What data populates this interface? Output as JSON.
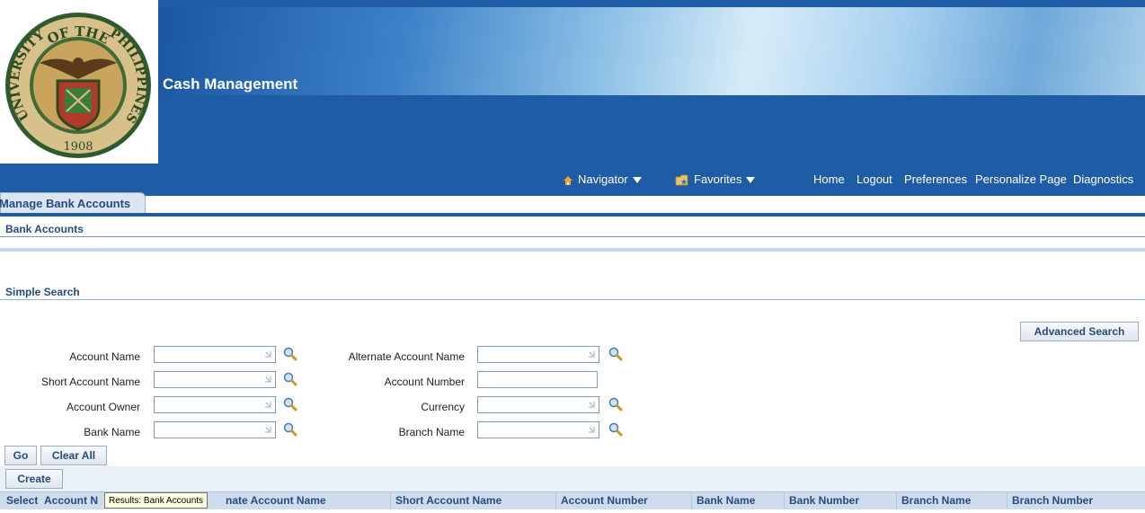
{
  "header": {
    "app_title": "Cash Management",
    "seal": {
      "top_text": "OF THE",
      "left_text": "UNIVERSITY",
      "right_text": "PHILIPPINES",
      "year": "1908"
    }
  },
  "global_nav": {
    "navigator": "Navigator",
    "favorites": "Favorites",
    "links": [
      "Home",
      "Logout",
      "Preferences",
      "Personalize Page",
      "Diagnostics"
    ]
  },
  "tabs": {
    "active": "Manage Bank Accounts"
  },
  "subtab": "Bank Accounts",
  "search": {
    "section_title": "Simple Search",
    "advanced_button": "Advanced Search",
    "fields_left": [
      {
        "label": "Account Name",
        "value": "",
        "lov": true
      },
      {
        "label": "Short Account Name",
        "value": "",
        "lov": true
      },
      {
        "label": "Account Owner",
        "value": "",
        "lov": true
      },
      {
        "label": "Bank Name",
        "value": "",
        "lov": true
      }
    ],
    "fields_right": [
      {
        "label": "Alternate Account Name",
        "value": "",
        "lov": true
      },
      {
        "label": "Account Number",
        "value": "",
        "lov": false
      },
      {
        "label": "Currency",
        "value": "",
        "lov": true
      },
      {
        "label": "Branch Name",
        "value": "",
        "lov": true
      }
    ],
    "go_button": "Go",
    "clear_button": "Clear All"
  },
  "results": {
    "create_button": "Create",
    "columns": [
      "Select",
      "Account N",
      "nate Account Name",
      "Short Account Name",
      "Account Number",
      "Bank Name",
      "Bank Number",
      "Branch Name",
      "Branch Number"
    ],
    "tooltip": "Results: Bank Accounts"
  },
  "colors": {
    "header_blue": "#1f5ca6",
    "label_blue": "#254b80",
    "table_header": "#cfdced"
  }
}
